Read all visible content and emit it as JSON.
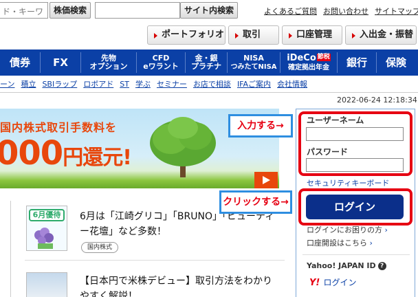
{
  "search": {
    "keyword_placeholder": "銘柄名・コード・キーワード",
    "keyword_visible": "ド・キーワ",
    "price_button": "株価検索",
    "site_button": "サイト内検索",
    "site_value": ""
  },
  "top_links": [
    "よくあるご質問",
    "お問い合わせ",
    "サイトマップ"
  ],
  "account_nav": [
    "ポートフォリオ",
    "取引",
    "口座管理",
    "入出金・振替"
  ],
  "main_nav": [
    {
      "label": "債券"
    },
    {
      "label": "FX"
    },
    {
      "line1": "先物",
      "line2": "オプション"
    },
    {
      "line1": "CFD",
      "line2": "eワラント"
    },
    {
      "line1": "金・銀",
      "line2": "プラチナ"
    },
    {
      "line1": "NISA",
      "line2": "つみたてNISA"
    },
    {
      "line1": "iDeCo",
      "badge": "節税",
      "line2": "確定拠出年金"
    },
    {
      "label": "銀行"
    },
    {
      "label": "保険"
    }
  ],
  "sub_nav": [
    "ーン",
    "積立",
    "SBIラップ",
    "ロボアド",
    "ST",
    "学ぶ",
    "セミナー",
    "お店で相談",
    "IFAご案内",
    "会社情報"
  ],
  "datetime": "2022-06-24 12:18:34",
  "banner": {
    "line1": "国内株式取引手数料を",
    "line2_num": "000",
    "line2_unit": "円還元!"
  },
  "news": [
    {
      "badge": "6月優待",
      "title": "6月は「江崎グリコ」「BRUNO」「ビューティー花壇」など多数！",
      "tag": "国内株式"
    },
    {
      "title": "【日本円で米株デビュー】取引方法をわかりやすく解説！"
    }
  ],
  "annotations": {
    "input": "入力する→",
    "click": "クリックする→"
  },
  "login": {
    "username_label": "ユーザーネーム",
    "username_value": "",
    "password_label": "パスワード",
    "password_value": "",
    "security_keyboard": "セキュリティキーボード",
    "login_button": "ログイン",
    "trouble_link": "ログインにお困りの方",
    "open_account_link": "口座開設はこちら",
    "yahoo_id_label": "Yahoo! JAPAN ID",
    "yahoo_logo": "Y!",
    "yahoo_login": "ログイン"
  },
  "colors": {
    "nav_blue": "#0b40a6",
    "login_button": "#0b2f8a",
    "annotation_red": "#e60012",
    "annotation_blue": "#2e8ee0",
    "banner_orange": "#e8470c"
  }
}
